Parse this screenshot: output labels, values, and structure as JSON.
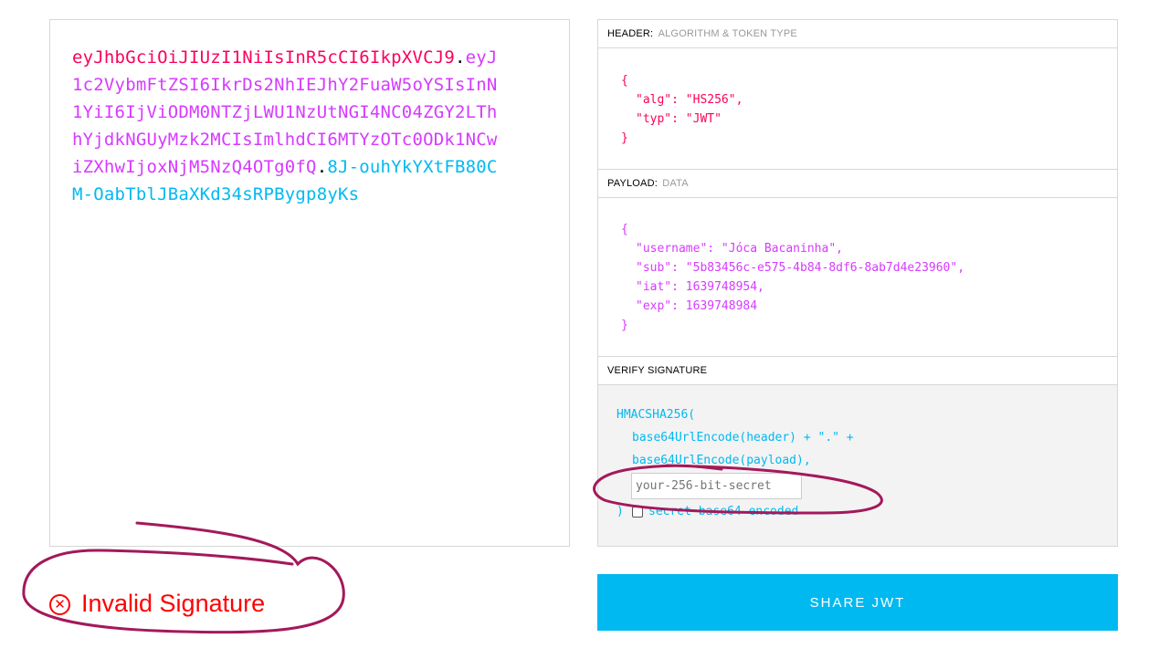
{
  "encoded": {
    "header": "eyJhbGciOiJIUzI1NiIsInR5cCI6IkpXVCJ9",
    "payload": "eyJ1c2VybmFtZSI6IkrDs2NhIEJhY2FuaW5oYSIsInN1YiI6IjViODM0NTZjLWU1NzUtNGI4NC04ZGY2LThhYjdkNGUyMzk2MCIsImlhdCI6MTYzOTc0ODk1NCwiZXhwIjoxNjM5NzQ4OTg0fQ",
    "signature": "8J-ouhYkYXtFB80CM-OabTblJBaXKd34sRPBygp8yKs",
    "dot": ".",
    "colors": {
      "header": "#fb015b",
      "payload": "#d63aff",
      "signature": "#00b9f1"
    }
  },
  "header_section": {
    "title": "HEADER:",
    "subtitle": "ALGORITHM & TOKEN TYPE",
    "open": "{",
    "close": "}",
    "lines": [
      "\"alg\": \"HS256\",",
      "\"typ\": \"JWT\""
    ]
  },
  "payload_section": {
    "title": "PAYLOAD:",
    "subtitle": "DATA",
    "open": "{",
    "close": "}",
    "lines": [
      "\"username\": \"Jóca Bacaninha\",",
      "\"sub\": \"5b83456c-e575-4b84-8df6-8ab7d4e23960\",",
      "\"iat\": 1639748954,",
      "\"exp\": 1639748984"
    ]
  },
  "signature_section": {
    "title": "VERIFY SIGNATURE",
    "fn_open": "HMACSHA256(",
    "line1": "base64UrlEncode(header) + \".\" +",
    "line2": "base64UrlEncode(payload),",
    "secret_placeholder": "your-256-bit-secret",
    "close": ")",
    "checkbox_label": "secret base64 encoded"
  },
  "status": {
    "icon": "x-circle-icon",
    "text": "Invalid Signature",
    "color": "#ff0000"
  },
  "share_button": {
    "label": "SHARE JWT",
    "color": "#00b9f1"
  }
}
